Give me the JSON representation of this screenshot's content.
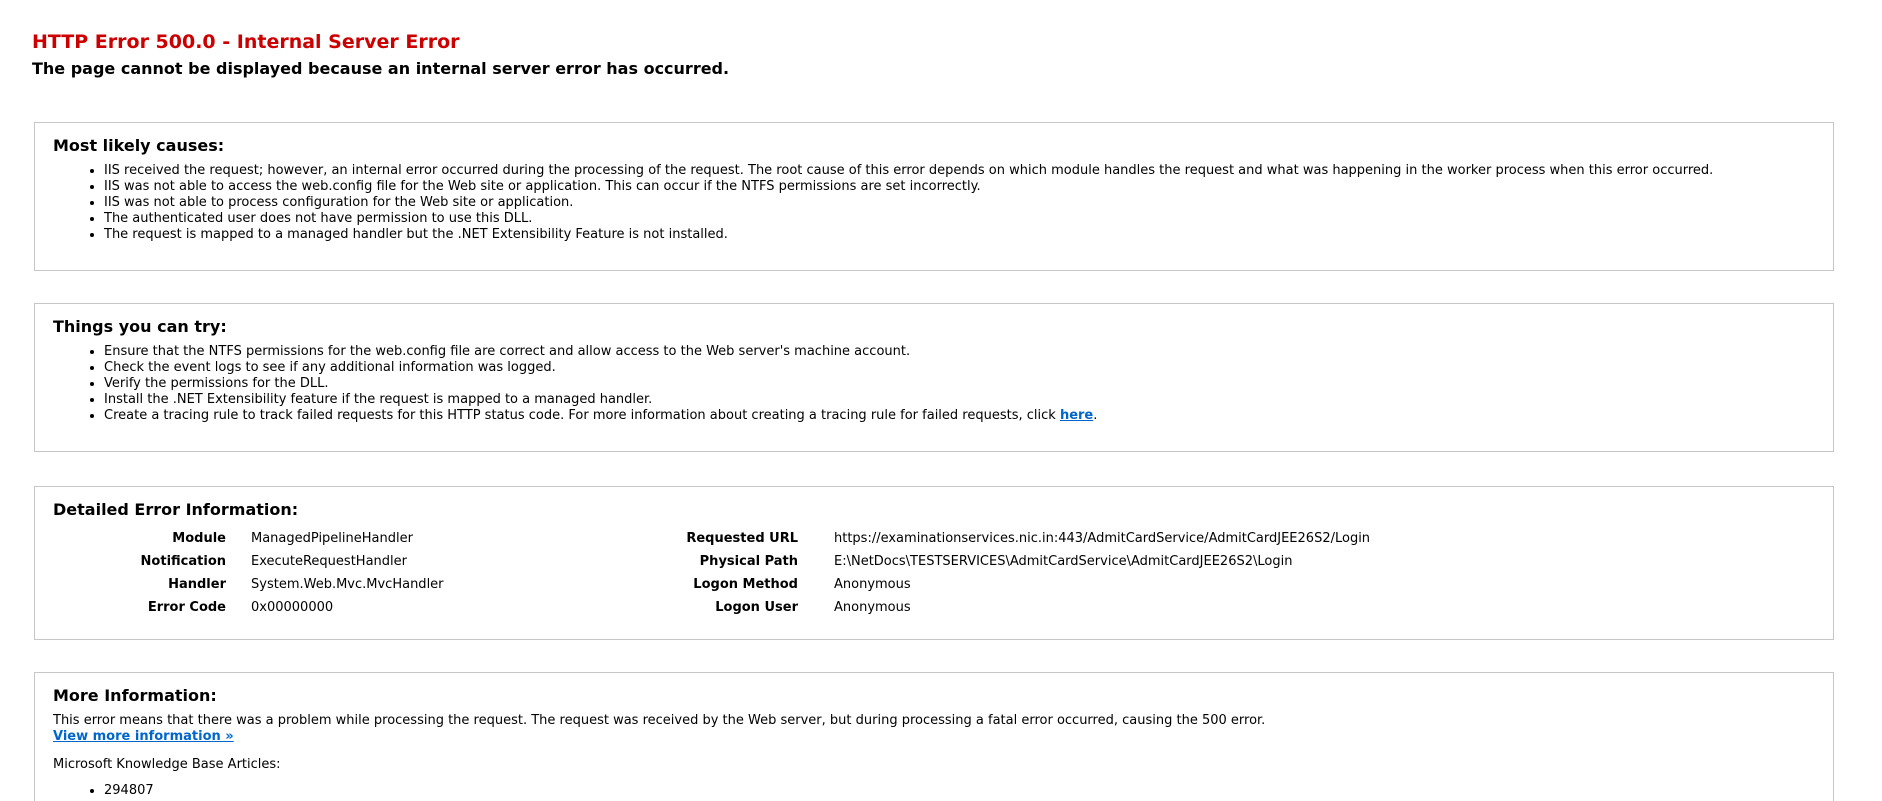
{
  "header": {
    "title": "HTTP Error 500.0 - Internal Server Error",
    "subtitle": "The page cannot be displayed because an internal server error has occurred."
  },
  "causes": {
    "title": "Most likely causes:",
    "items": [
      "IIS received the request; however, an internal error occurred during the processing of the request. The root cause of this error depends on which module handles the request and what was happening in the worker process when this error occurred.",
      "IIS was not able to access the web.config file for the Web site or application. This can occur if the NTFS permissions are set incorrectly.",
      "IIS was not able to process configuration for the Web site or application.",
      "The authenticated user does not have permission to use this DLL.",
      "The request is mapped to a managed handler but the .NET Extensibility Feature is not installed."
    ]
  },
  "try": {
    "title": "Things you can try:",
    "items": [
      "Ensure that the NTFS permissions for the web.config file are correct and allow access to the Web server's machine account.",
      "Check the event logs to see if any additional information was logged.",
      "Verify the permissions for the DLL.",
      "Install the .NET Extensibility feature if the request is mapped to a managed handler."
    ],
    "last_item_text": "Create a tracing rule to track failed requests for this HTTP status code. For more information about creating a tracing rule for failed requests, click ",
    "last_item_link": "here",
    "last_item_suffix": "."
  },
  "details": {
    "title": "Detailed Error Information:",
    "left": [
      {
        "label": "Module",
        "value": "ManagedPipelineHandler"
      },
      {
        "label": "Notification",
        "value": "ExecuteRequestHandler"
      },
      {
        "label": "Handler",
        "value": "System.Web.Mvc.MvcHandler"
      },
      {
        "label": "Error Code",
        "value": "0x00000000"
      }
    ],
    "right": [
      {
        "label": "Requested URL",
        "value": "https://examinationservices.nic.in:443/AdmitCardService/AdmitCardJEE26S2/Login"
      },
      {
        "label": "Physical Path",
        "value": "E:\\NetDocs\\TESTSERVICES\\AdmitCardService\\AdmitCardJEE26S2\\Login"
      },
      {
        "label": "Logon Method",
        "value": "Anonymous"
      },
      {
        "label": "Logon User",
        "value": "Anonymous"
      }
    ]
  },
  "more": {
    "title": "More Information:",
    "text": "This error means that there was a problem while processing the request. The request was received by the Web server, but during processing a fatal error occurred, causing the 500 error.",
    "link": "View more information »",
    "kb_label": "Microsoft Knowledge Base Articles:",
    "kb_items": [
      "294807"
    ]
  },
  "colors": {
    "title_red": "#cc0000",
    "link_blue": "#0066cc",
    "panel_border": "#c6c6c6"
  }
}
